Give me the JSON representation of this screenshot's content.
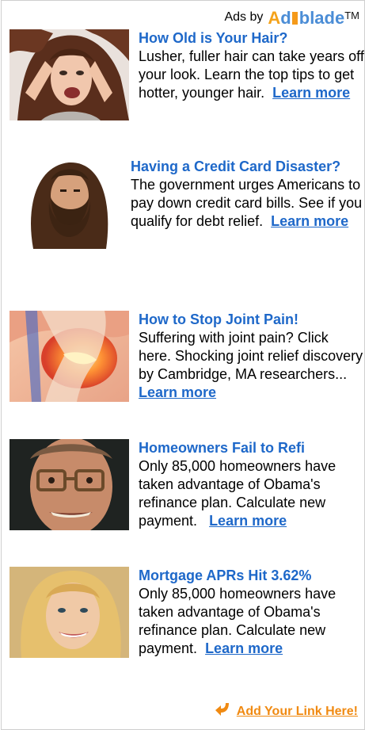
{
  "header": {
    "ads_by": "Ads by",
    "logo_a": "A",
    "logo_d": "d",
    "logo_rest": "blade",
    "logo_tm": "TM"
  },
  "ads": [
    {
      "title": "How Old is Your Hair?",
      "body": "Lusher, fuller hair can take years off your look. Learn the top tips to get hotter, younger hair.",
      "link": "Learn more",
      "image": "woman-pulling-hair-photo"
    },
    {
      "title": "Having a Credit Card Disaster?",
      "body": "The government urges Americans to pay down credit card bills. See if you qualify for debt relief.",
      "link": "Learn more",
      "image": "bearded-man-photo"
    },
    {
      "title": "How to Stop Joint Pain!",
      "body": "Suffering with joint pain? Click here. Shocking joint relief discovery by Cambridge, MA researchers...",
      "link": "Learn more",
      "image": "knee-joint-illustration"
    },
    {
      "title": "Homeowners Fail to Refi",
      "body": "Only 85,000 homeowners have taken advantage of Obama's refinance plan. Calculate new payment.",
      "link": "Learn more",
      "image": "man-with-glasses-photo"
    },
    {
      "title": "Mortgage APRs Hit 3.62%",
      "body": "Only 85,000 homeowners have taken advantage of Obama's refinance plan. Calculate new payment.",
      "link": "Learn more",
      "image": "smiling-blonde-woman-photo"
    }
  ],
  "footer": {
    "add_link": "Add Your Link Here!",
    "icon": "curved-arrow-icon"
  },
  "colors": {
    "link_blue": "#1e68c9",
    "orange": "#f08a12",
    "logo_blue": "#4b8dd6"
  }
}
